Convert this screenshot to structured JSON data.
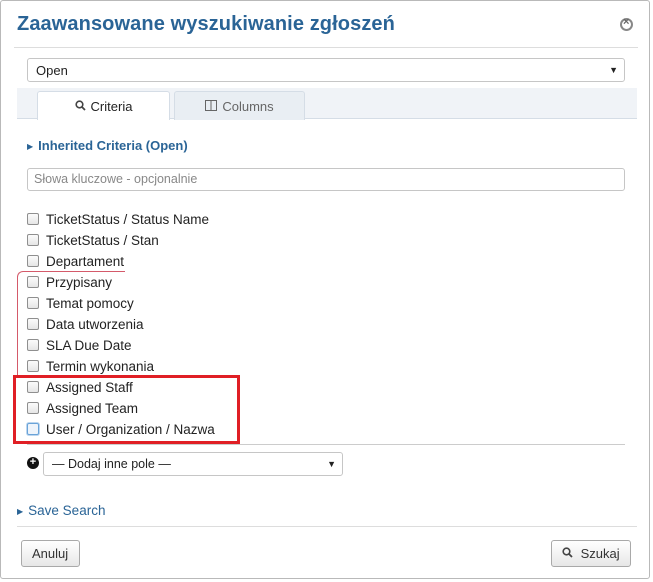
{
  "dialog": {
    "title": "Zaawansowane wyszukiwanie zgłoszeń",
    "queue_select": "Open"
  },
  "tabs": [
    {
      "label": "Criteria",
      "icon": "search-icon",
      "active": true
    },
    {
      "label": "Columns",
      "icon": "columns-icon",
      "active": false
    }
  ],
  "criteria": {
    "inherited_label": "Inherited Criteria (Open)",
    "keywords_placeholder": "Słowa kluczowe - opcjonalnie",
    "fields": [
      {
        "label": "TicketStatus / Status Name",
        "checked": false
      },
      {
        "label": "TicketStatus / Stan",
        "checked": false
      },
      {
        "label": "Departament",
        "checked": false
      },
      {
        "label": "Przypisany",
        "checked": false
      },
      {
        "label": "Temat pomocy",
        "checked": false
      },
      {
        "label": "Data utworzenia",
        "checked": false
      },
      {
        "label": "SLA Due Date",
        "checked": false
      },
      {
        "label": "Termin wykonania",
        "checked": false
      },
      {
        "label": "Assigned Staff",
        "checked": false
      },
      {
        "label": "Assigned Team",
        "checked": false
      },
      {
        "label": "User / Organization / Nazwa",
        "checked": false
      }
    ],
    "add_field_select": "— Dodaj inne pole —"
  },
  "footer": {
    "save_search_label": "Save Search",
    "cancel_label": "Anuluj",
    "search_label": "Szukaj"
  },
  "colors": {
    "title": "#2a6496",
    "annotation": "#e01f25"
  }
}
